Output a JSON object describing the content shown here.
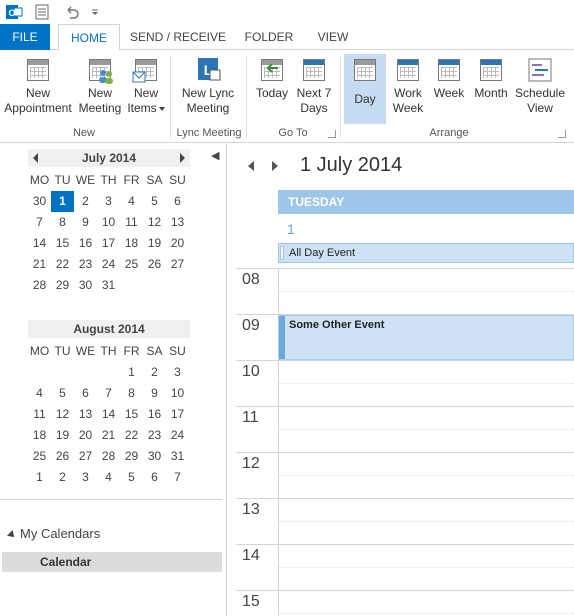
{
  "qat": {
    "icons": [
      "outlook-icon",
      "send-receive-icon",
      "undo-icon",
      "customize-icon"
    ]
  },
  "tabs": [
    {
      "label": "FILE"
    },
    {
      "label": "HOME"
    },
    {
      "label": "SEND / RECEIVE"
    },
    {
      "label": "FOLDER"
    },
    {
      "label": "VIEW"
    }
  ],
  "ribbon": {
    "new_appointment": "New\nAppointment",
    "new_meeting": "New\nMeeting",
    "new_items": "New\nItems",
    "new_lync_meeting": "New Lync\nMeeting",
    "today": "Today",
    "next7": "Next 7\nDays",
    "day": "Day",
    "work_week": "Work\nWeek",
    "week": "Week",
    "month": "Month",
    "schedule_view": "Schedule\nView",
    "groups": {
      "new": "New",
      "lync": "Lync Meeting",
      "goto": "Go To",
      "arrange": "Arrange"
    }
  },
  "mini_cal": {
    "dow": [
      "MO",
      "TU",
      "WE",
      "TH",
      "FR",
      "SA",
      "SU"
    ],
    "july": {
      "title": "July 2014",
      "weeks": [
        [
          "30",
          "1",
          "2",
          "3",
          "4",
          "5",
          "6"
        ],
        [
          "7",
          "8",
          "9",
          "10",
          "11",
          "12",
          "13"
        ],
        [
          "14",
          "15",
          "16",
          "17",
          "18",
          "19",
          "20"
        ],
        [
          "21",
          "22",
          "23",
          "24",
          "25",
          "26",
          "27"
        ],
        [
          "28",
          "29",
          "30",
          "31",
          "",
          "",
          ""
        ]
      ]
    },
    "august": {
      "title": "August 2014",
      "weeks": [
        [
          "",
          "",
          "",
          "",
          "1",
          "2",
          "3"
        ],
        [
          "4",
          "5",
          "6",
          "7",
          "8",
          "9",
          "10"
        ],
        [
          "11",
          "12",
          "13",
          "14",
          "15",
          "16",
          "17"
        ],
        [
          "18",
          "19",
          "20",
          "21",
          "22",
          "23",
          "24"
        ],
        [
          "25",
          "26",
          "27",
          "28",
          "29",
          "30",
          "31"
        ],
        [
          "1",
          "2",
          "3",
          "4",
          "5",
          "6",
          "7"
        ]
      ]
    }
  },
  "calendars": {
    "section_label": "My Calendars",
    "items": [
      "Calendar"
    ]
  },
  "dayview": {
    "title": "1 July 2014",
    "day_header": "TUESDAY",
    "day_number": "1",
    "all_day_event": "All Day Event",
    "hours": [
      "08",
      "09",
      "10",
      "11",
      "12",
      "13",
      "14",
      "15"
    ],
    "event": "Some Other Event"
  }
}
